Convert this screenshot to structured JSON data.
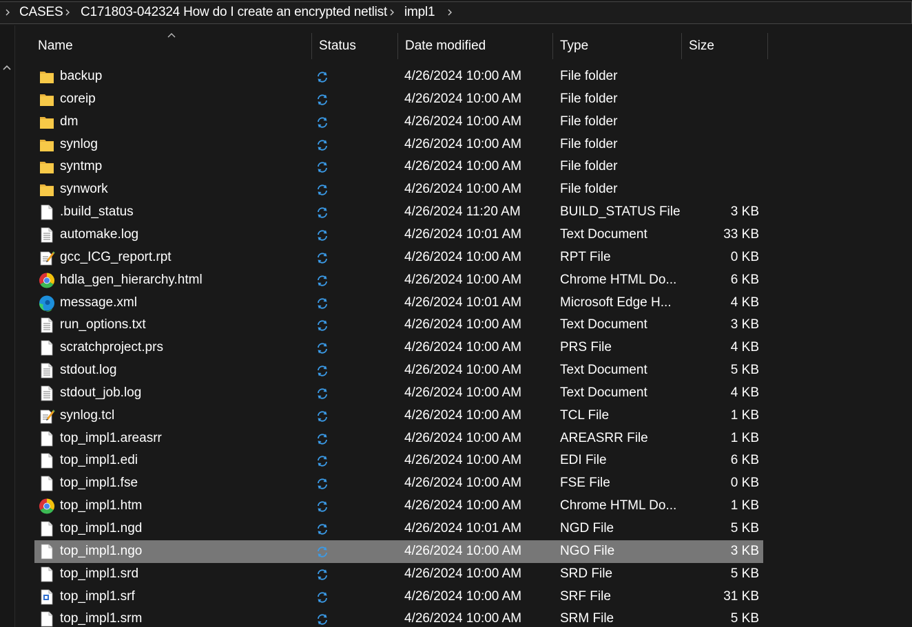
{
  "breadcrumb": [
    "CASES",
    "C171803-042324 How do I create an encrypted netlist",
    "impl1"
  ],
  "columns": {
    "name": "Name",
    "status": "Status",
    "date": "Date modified",
    "type": "Type",
    "size": "Size"
  },
  "colors": {
    "background": "#191919",
    "selected_row": "#777777",
    "sync_icon": "#3b9be8",
    "folder": "#f7c948"
  },
  "files": [
    {
      "name": "backup",
      "icon": "folder-icon",
      "date": "4/26/2024 10:00 AM",
      "type": "File folder",
      "size": ""
    },
    {
      "name": "coreip",
      "icon": "folder-icon",
      "date": "4/26/2024 10:00 AM",
      "type": "File folder",
      "size": ""
    },
    {
      "name": "dm",
      "icon": "folder-icon",
      "date": "4/26/2024 10:00 AM",
      "type": "File folder",
      "size": ""
    },
    {
      "name": "synlog",
      "icon": "folder-icon",
      "date": "4/26/2024 10:00 AM",
      "type": "File folder",
      "size": ""
    },
    {
      "name": "syntmp",
      "icon": "folder-icon",
      "date": "4/26/2024 10:00 AM",
      "type": "File folder",
      "size": ""
    },
    {
      "name": "synwork",
      "icon": "folder-icon",
      "date": "4/26/2024 10:00 AM",
      "type": "File folder",
      "size": ""
    },
    {
      "name": ".build_status",
      "icon": "blank-file-icon",
      "date": "4/26/2024 11:20 AM",
      "type": "BUILD_STATUS File",
      "size": "3 KB"
    },
    {
      "name": "automake.log",
      "icon": "text-file-icon",
      "date": "4/26/2024 10:01 AM",
      "type": "Text Document",
      "size": "33 KB"
    },
    {
      "name": "gcc_ICG_report.rpt",
      "icon": "edit-file-icon",
      "date": "4/26/2024 10:00 AM",
      "type": "RPT File",
      "size": "0 KB"
    },
    {
      "name": "hdla_gen_hierarchy.html",
      "icon": "chrome-icon",
      "date": "4/26/2024 10:00 AM",
      "type": "Chrome HTML Do...",
      "size": "6 KB"
    },
    {
      "name": "message.xml",
      "icon": "edge-icon",
      "date": "4/26/2024 10:01 AM",
      "type": "Microsoft Edge H...",
      "size": "4 KB"
    },
    {
      "name": "run_options.txt",
      "icon": "text-file-icon",
      "date": "4/26/2024 10:00 AM",
      "type": "Text Document",
      "size": "3 KB"
    },
    {
      "name": "scratchproject.prs",
      "icon": "blank-file-icon",
      "date": "4/26/2024 10:00 AM",
      "type": "PRS File",
      "size": "4 KB"
    },
    {
      "name": "stdout.log",
      "icon": "text-file-icon",
      "date": "4/26/2024 10:00 AM",
      "type": "Text Document",
      "size": "5 KB"
    },
    {
      "name": "stdout_job.log",
      "icon": "text-file-icon",
      "date": "4/26/2024 10:00 AM",
      "type": "Text Document",
      "size": "4 KB"
    },
    {
      "name": "synlog.tcl",
      "icon": "edit-file-icon",
      "date": "4/26/2024 10:00 AM",
      "type": "TCL File",
      "size": "1 KB"
    },
    {
      "name": "top_impl1.areasrr",
      "icon": "blank-file-icon",
      "date": "4/26/2024 10:00 AM",
      "type": "AREASRR File",
      "size": "1 KB"
    },
    {
      "name": "top_impl1.edi",
      "icon": "blank-file-icon",
      "date": "4/26/2024 10:00 AM",
      "type": "EDI File",
      "size": "6 KB"
    },
    {
      "name": "top_impl1.fse",
      "icon": "blank-file-icon",
      "date": "4/26/2024 10:00 AM",
      "type": "FSE File",
      "size": "0 KB"
    },
    {
      "name": "top_impl1.htm",
      "icon": "chrome-icon",
      "date": "4/26/2024 10:00 AM",
      "type": "Chrome HTML Do...",
      "size": "1 KB"
    },
    {
      "name": "top_impl1.ngd",
      "icon": "blank-file-icon",
      "date": "4/26/2024 10:01 AM",
      "type": "NGD File",
      "size": "5 KB"
    },
    {
      "name": "top_impl1.ngo",
      "icon": "blank-file-icon",
      "date": "4/26/2024 10:00 AM",
      "type": "NGO File",
      "size": "3 KB",
      "selected": true
    },
    {
      "name": "top_impl1.srd",
      "icon": "blank-file-icon",
      "date": "4/26/2024 10:00 AM",
      "type": "SRD File",
      "size": "5 KB"
    },
    {
      "name": "top_impl1.srf",
      "icon": "srf-file-icon",
      "date": "4/26/2024 10:00 AM",
      "type": "SRF File",
      "size": "31 KB"
    },
    {
      "name": "top_impl1.srm",
      "icon": "blank-file-icon",
      "date": "4/26/2024 10:00 AM",
      "type": "SRM File",
      "size": "5 KB"
    }
  ]
}
